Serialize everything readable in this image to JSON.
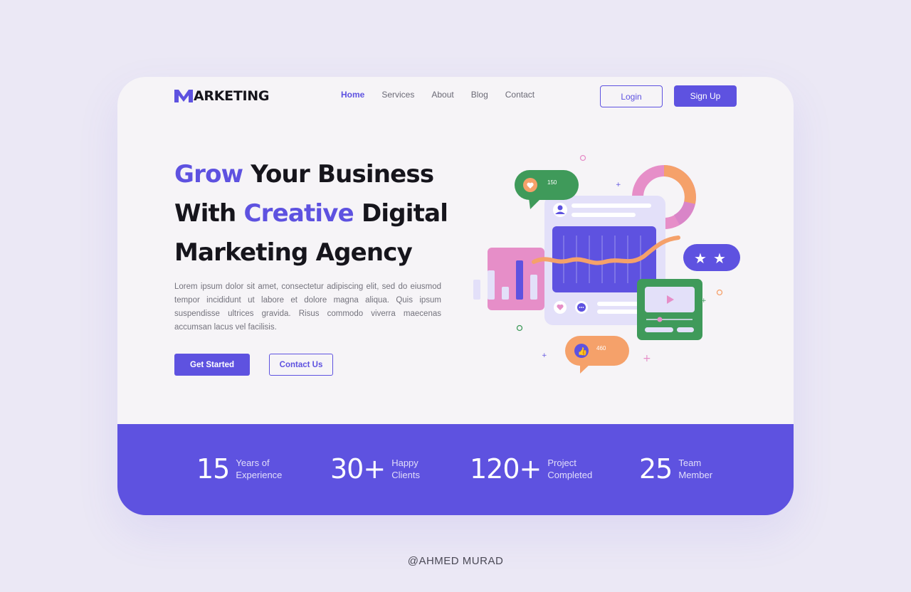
{
  "brand": {
    "name": "ARKETING",
    "accent": "#5e52e0"
  },
  "nav": {
    "items": [
      {
        "label": "Home"
      },
      {
        "label": "Services"
      },
      {
        "label": "About"
      },
      {
        "label": "Blog"
      },
      {
        "label": "Contact"
      }
    ],
    "active": "Home"
  },
  "auth": {
    "login_label": "Login",
    "signup_label": "Sign Up"
  },
  "hero": {
    "headline_line1_highlight": "Grow",
    "headline_line1_rest": " Your Business",
    "headline_line2_pre": "With ",
    "headline_line2_highlight": "Creative",
    "headline_line2_rest": " Digital",
    "headline_line3": "Marketing Agency",
    "paragraph": "Lorem ipsum dolor sit amet, consectetur adipiscing elit, sed do eiusmod tempor incididunt ut labore et dolore magna aliqua. Quis ipsum suspendisse ultrices gravida. Risus commodo viverra maecenas accumsan lacus vel facilisis.",
    "primary_cta": "Get Started",
    "secondary_cta": "Contact Us"
  },
  "illustration": {
    "likes_count": "150",
    "thumbs_count": "460",
    "icons": [
      "heart-icon",
      "thumbs-up-icon",
      "user-icon",
      "chat-icon",
      "star-icon",
      "play-icon"
    ]
  },
  "stats": [
    {
      "value": "15",
      "label_line1": "Years of",
      "label_line2": "Experience"
    },
    {
      "value": "30+",
      "label_line1": "Happy",
      "label_line2": "Clients"
    },
    {
      "value": "120+",
      "label_line1": "Project",
      "label_line2": "Completed"
    },
    {
      "value": "25",
      "label_line1": "Team",
      "label_line2": "Member"
    }
  ],
  "credit": "@AHMED MURAD",
  "colors": {
    "accent": "#5e52e0",
    "pink": "#e68ec8",
    "orange": "#f5a16a",
    "green": "#3f9a5a",
    "lavender": "#e3e0f9"
  }
}
